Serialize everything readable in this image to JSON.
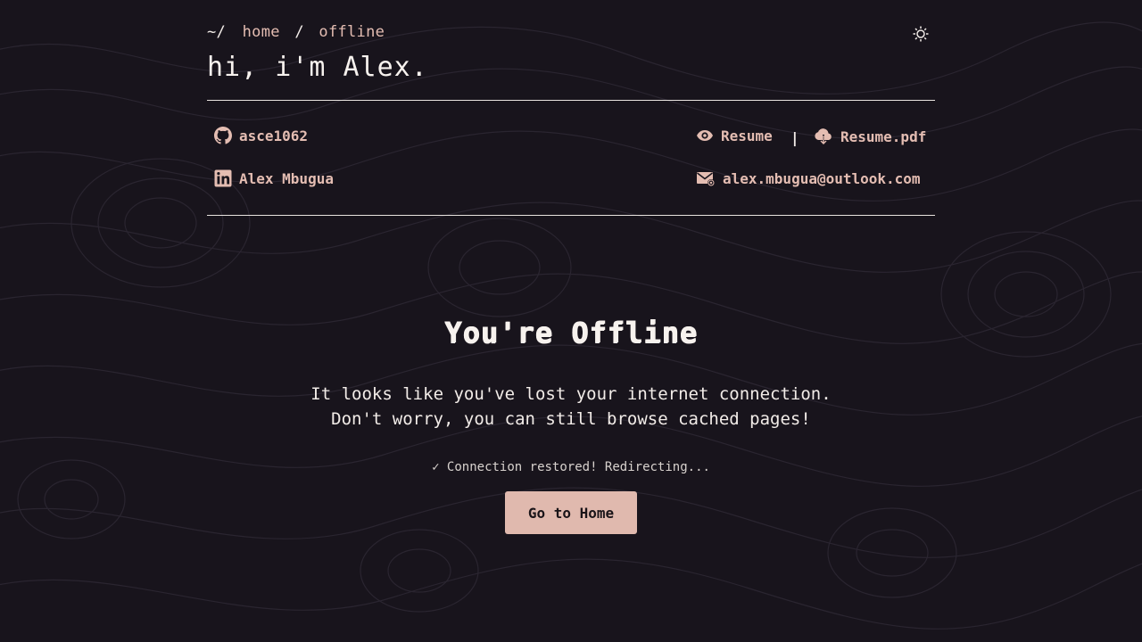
{
  "breadcrumb": {
    "root": "~/",
    "items": [
      "home",
      "offline"
    ],
    "separator": "/"
  },
  "header": {
    "title": "hi, i'm Alex."
  },
  "contacts": {
    "github": "asce1062",
    "linkedin": "Alex Mbugua",
    "resume": "Resume",
    "pipe": "|",
    "resume_pdf": "Resume.pdf",
    "email": "alex.mbugua@outlook.com"
  },
  "main": {
    "title": "You're Offline",
    "message_line1": "It looks like you've lost your internet connection.",
    "message_line2": "Don't worry, you can still browse cached pages!",
    "status": "✓ Connection restored! Redirecting...",
    "button_label": "Go to Home"
  },
  "colors": {
    "background": "#18141c",
    "accent": "#e0b9ae",
    "text": "#f2ece8"
  },
  "icons": {
    "theme": "sun-icon",
    "github": "github-icon",
    "linkedin": "linkedin-icon",
    "resume": "eye-icon",
    "pdf": "cloud-download-icon",
    "email": "mail-icon"
  }
}
